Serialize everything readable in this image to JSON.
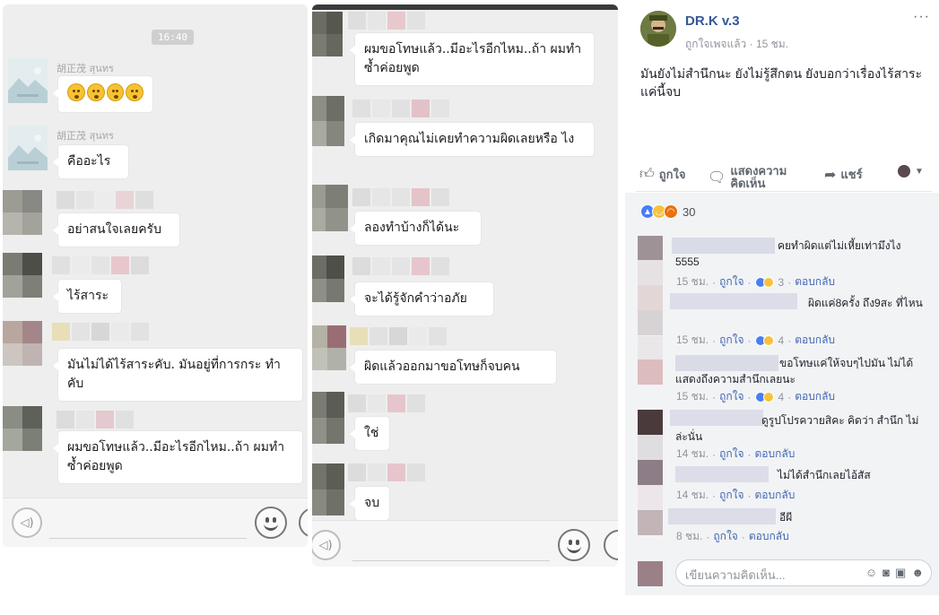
{
  "chat_left": {
    "timestamp": "16:40",
    "messages": [
      {
        "sender": "胡正茂 สุนทร",
        "text": ""
      },
      {
        "sender": "胡正茂 สุนทร",
        "text": "คืออะไร"
      },
      {
        "sender": "",
        "text": "อย่าสนใจเลยครับ"
      },
      {
        "sender": "",
        "text": "ไร้สาระ"
      },
      {
        "sender": "",
        "text": "มันไม่ได้ไร้สาระคับ. มันอยู่ที่การกระ ทำคับ"
      },
      {
        "sender": "",
        "text": "ผมขอโทษแล้ว..มีอะไรอีกไหม..ถ้า ผมทำซ้ำค่อยพูด"
      }
    ]
  },
  "chat_right": {
    "messages": [
      {
        "text": "ผมขอโทษแล้ว..มีอะไรอีกไหม..ถ้า ผมทำซ้ำค่อยพูด"
      },
      {
        "text": "เกิดมาคุณไม่เคยทำความผิดเลยหรือ ไง"
      },
      {
        "text": "ลองทำบ้างก็ได้นะ"
      },
      {
        "text": "จะได้รู้จักคำว่าอภัย"
      },
      {
        "text": "ผิดแล้วออกมาขอโทษก็จบคน"
      },
      {
        "text": "ใช่"
      },
      {
        "text": "จบ"
      }
    ]
  },
  "fb_post": {
    "page_name": "DR.K v.3",
    "meta_liked": "ถูกใจเพจแล้ว",
    "meta_time": "15 ชม.",
    "meta_sep": "·",
    "more": "···",
    "text": "มันยังไม่สำนึกนะ ยังไม่รู้สึกตน ยังบอกว่าเรื่องไร้สาระ แค่นี้จบ",
    "actions": {
      "like": "ถูกใจ",
      "comment": "แสดงความคิดเห็น",
      "share": "แชร์"
    },
    "reaction_count": "30",
    "comments": [
      {
        "text": "คยทำผิดแต่ไม่เหี้ยเท่ามึงไง 5555",
        "time": "15 ชม.",
        "like": "ถูกใจ",
        "count": "3",
        "reply": "ตอบกลับ"
      },
      {
        "text": "ผิดแค่8ครั้ง ถึง9สะ ที่ไหน",
        "time": "15 ชม.",
        "like": "ถูกใจ",
        "count": "4",
        "reply": "ตอบกลับ"
      },
      {
        "text": "ขอโทษแค่ให้จบๆไปมัน ไม่ได้แสดงถึงความสำนึกเลยนะ",
        "time": "15 ชม.",
        "like": "ถูกใจ",
        "count": "4",
        "reply": "ตอบกลับ"
      },
      {
        "text": "ดูรูปโปรควายสิคะ คิดว่า สำนึก ไม่ล่ะนั่น",
        "time": "14 ชม.",
        "like": "ถูกใจ",
        "count": "",
        "reply": "ตอบกลับ"
      },
      {
        "text": "ไม่ได้สำนึกเลยไอ้สัส",
        "time": "14 ชม.",
        "like": "ถูกใจ",
        "count": "",
        "reply": "ตอบกลับ"
      },
      {
        "text": "อีผี",
        "time": "8 ชม.",
        "like": "ถูกใจ",
        "count": "",
        "reply": "ตอบกลับ"
      }
    ],
    "write_placeholder": "เขียนความคิดเห็น..."
  }
}
